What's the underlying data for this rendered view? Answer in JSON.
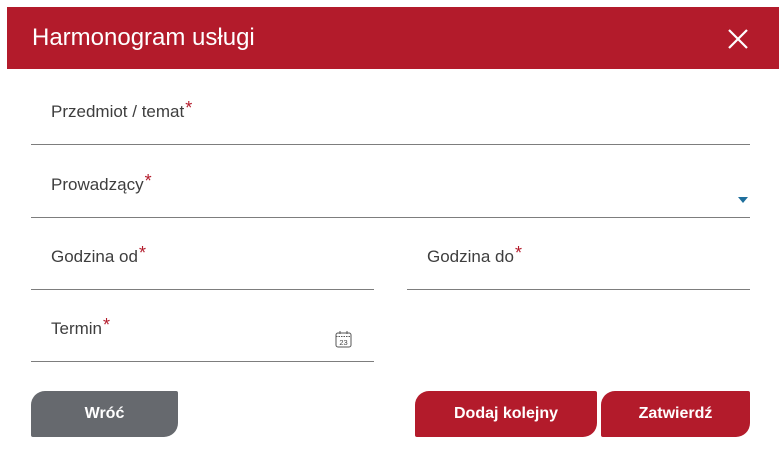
{
  "dialog": {
    "title": "Harmonogram usługi",
    "close_icon": "close-icon"
  },
  "form": {
    "required_mark": "*",
    "subject_label": "Przedmiot / temat",
    "instructor_label": "Prowadzący",
    "time_from_label": "Godzina od",
    "time_to_label": "Godzina do",
    "date_label": "Termin",
    "calendar_icon_day": "23"
  },
  "buttons": {
    "back_label": "Wróć",
    "add_another_label": "Dodaj kolejny",
    "confirm_label": "Zatwierdź"
  },
  "colors": {
    "accent": "#b31b2b",
    "secondary_button": "#66696e",
    "caret": "#1f6f9c"
  }
}
